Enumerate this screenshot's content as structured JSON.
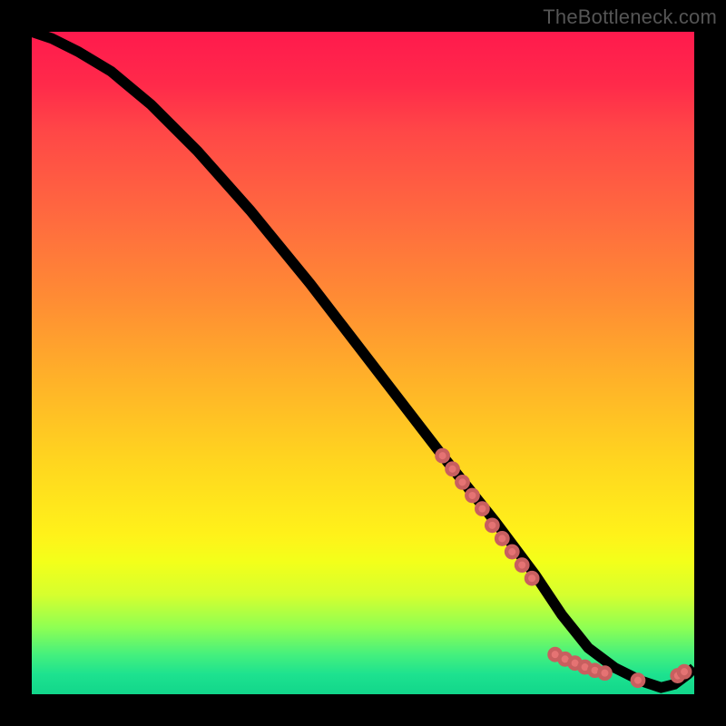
{
  "watermark": "TheBottleneck.com",
  "colors": {
    "background": "#000000",
    "gradient_top": "#ff1a4d",
    "gradient_bottom": "#12d68b",
    "curve": "#000000",
    "marker_fill": "#e57373",
    "marker_stroke": "#c85f5f"
  },
  "chart_data": {
    "type": "line",
    "title": "",
    "xlabel": "",
    "ylabel": "",
    "xlim": [
      0,
      100
    ],
    "ylim": [
      0,
      100
    ],
    "axes_visible": false,
    "grid": false,
    "series": [
      {
        "name": "curve",
        "x": [
          0,
          3,
          7,
          12,
          18,
          25,
          33,
          42,
          52,
          62,
          70,
          76,
          80,
          84,
          88,
          92,
          95,
          97,
          99,
          100
        ],
        "y": [
          100,
          99,
          97,
          94,
          89,
          82,
          73,
          62,
          49,
          36,
          26,
          18,
          12,
          7,
          4,
          2,
          1,
          1.5,
          3,
          4
        ]
      }
    ],
    "markers": [
      {
        "x": 62,
        "y": 36
      },
      {
        "x": 63.5,
        "y": 34
      },
      {
        "x": 65,
        "y": 32
      },
      {
        "x": 66.5,
        "y": 30
      },
      {
        "x": 68,
        "y": 28
      },
      {
        "x": 69.5,
        "y": 25.5
      },
      {
        "x": 71,
        "y": 23.5
      },
      {
        "x": 72.5,
        "y": 21.5
      },
      {
        "x": 74,
        "y": 19.5
      },
      {
        "x": 75.5,
        "y": 17.5
      },
      {
        "x": 79,
        "y": 6
      },
      {
        "x": 80.5,
        "y": 5.3
      },
      {
        "x": 82,
        "y": 4.7
      },
      {
        "x": 83.5,
        "y": 4.1
      },
      {
        "x": 85,
        "y": 3.6
      },
      {
        "x": 86.5,
        "y": 3.2
      },
      {
        "x": 91.5,
        "y": 2.1
      },
      {
        "x": 97.5,
        "y": 2.8
      },
      {
        "x": 98.5,
        "y": 3.4
      }
    ]
  }
}
